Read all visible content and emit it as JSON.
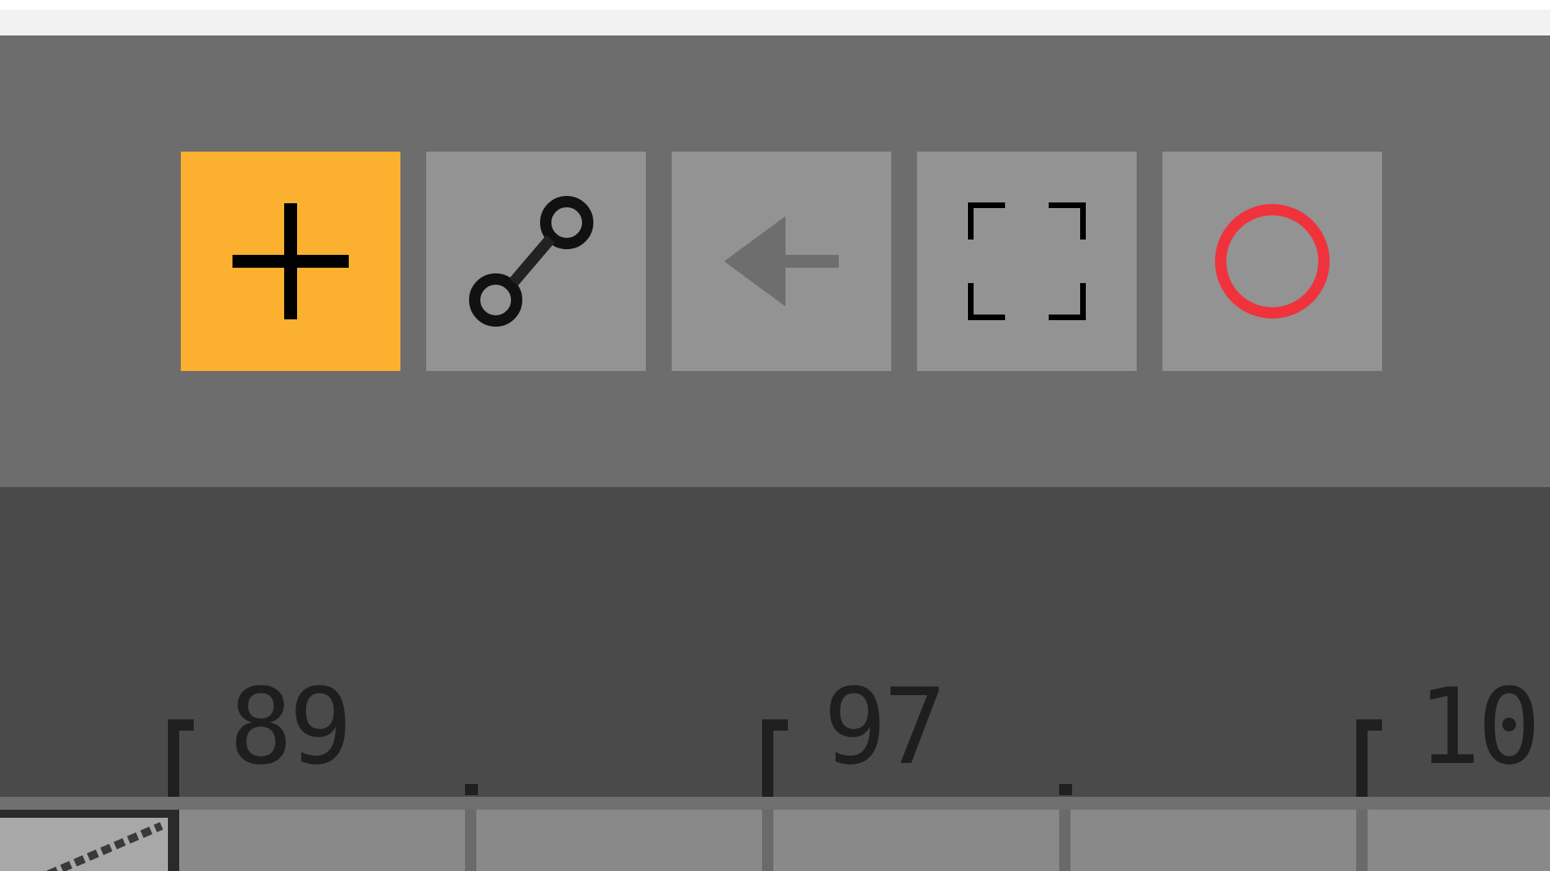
{
  "toolbar": {
    "tools": [
      {
        "name": "add",
        "icon": "plus-icon",
        "active": true
      },
      {
        "name": "connect",
        "icon": "link-nodes-icon",
        "active": false
      },
      {
        "name": "back",
        "icon": "arrow-left-icon",
        "active": false
      },
      {
        "name": "frame",
        "icon": "corners-icon",
        "active": false
      },
      {
        "name": "record",
        "icon": "circle-icon",
        "active": false
      }
    ],
    "colors": {
      "active_bg": "#fbb12f",
      "button_bg": "#939393",
      "toolbar_bg": "#6d6d6d",
      "record_color": "#f0323c"
    }
  },
  "ruler": {
    "labels": [
      "89",
      "97",
      "10"
    ]
  }
}
